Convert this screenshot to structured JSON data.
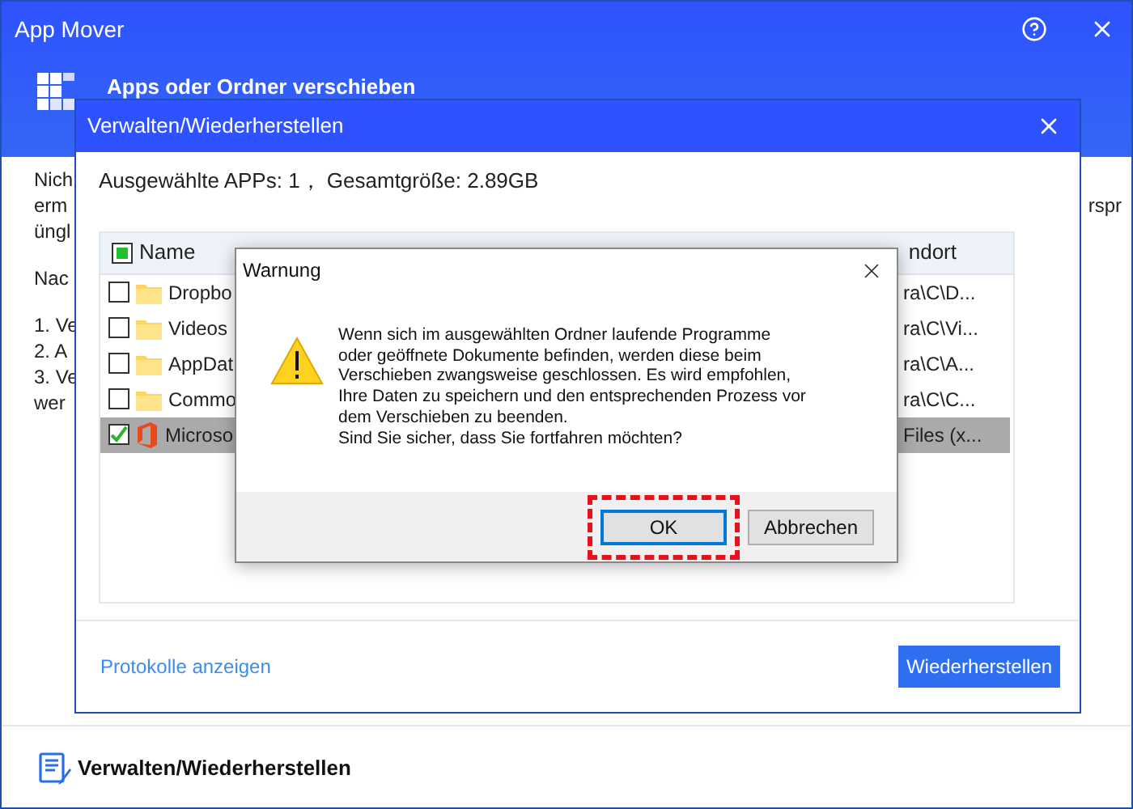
{
  "window": {
    "title": "App Mover",
    "heading": "Apps oder Ordner verschieben"
  },
  "body_text": [
    {
      "lines": [
        "Nich",
        "erm",
        "üngl"
      ]
    },
    {
      "lines": [
        "Nac"
      ]
    },
    {
      "lines": [
        "1. Ve",
        "2. A",
        "3. Ve",
        "wer"
      ]
    }
  ],
  "right_fragment": "rspr",
  "footer": {
    "label": "Verwalten/Wiederherstellen"
  },
  "manage_dialog": {
    "title": "Verwalten/Wiederherstellen",
    "summary": "Ausgewählte APPs: 1， Gesamtgröße: 2.89GB",
    "table": {
      "header_checked": true,
      "name_column": "Name",
      "location_column": "ndort",
      "rows": [
        {
          "name": "Dropbo",
          "kind": "folder",
          "location": "ra\\C\\D...",
          "checked": false,
          "selected": false
        },
        {
          "name": "Videos",
          "kind": "folder",
          "location": "ra\\C\\Vi...",
          "checked": false,
          "selected": false
        },
        {
          "name": "AppDat",
          "kind": "folder",
          "location": "ra\\C\\A...",
          "checked": false,
          "selected": false
        },
        {
          "name": "Commo",
          "kind": "folder",
          "location": "ra\\C\\C...",
          "checked": false,
          "selected": false
        },
        {
          "name": "Microso",
          "kind": "office",
          "location": "Files (x...",
          "checked": true,
          "selected": true
        }
      ]
    },
    "log_link": "Protokolle anzeigen",
    "restore_button": "Wiederherstellen"
  },
  "warning_dialog": {
    "title": "Warnung",
    "message_lines": [
      "Wenn sich im ausgewählten Ordner laufende Programme",
      "oder geöffnete Dokumente befinden, werden diese beim",
      "Verschieben zwangsweise geschlossen. Es wird empfohlen,",
      "Ihre Daten zu speichern und den entsprechenden Prozess vor",
      "dem Verschieben zu beenden.",
      "Sind Sie sicher, dass Sie fortfahren möchten?"
    ],
    "buttons": [
      {
        "label": "OK",
        "focused": true,
        "highlighted": true
      },
      {
        "label": "Abbrechen",
        "focused": false,
        "highlighted": false
      }
    ]
  }
}
